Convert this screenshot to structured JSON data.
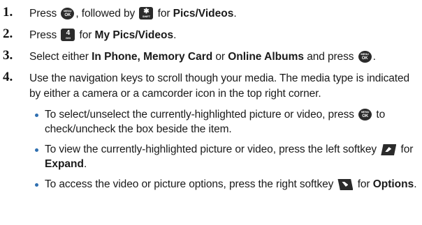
{
  "steps": [
    {
      "num": "1.",
      "t1": "Press ",
      "t2": ", followed by ",
      "t3": " for ",
      "bold": "Pics/Videos",
      "t4": ".",
      "icons": {
        "k1": "menu-ok-key-icon",
        "k2": "star-key-icon"
      },
      "key2": {
        "big": "✱",
        "small": "SHIFT"
      }
    },
    {
      "num": "2.",
      "t1": "Press ",
      "t2": " for ",
      "bold": "My Pics/Videos",
      "t3": ".",
      "icons": {
        "k1": "four-key-icon"
      },
      "key1": {
        "big": "4",
        "small": "GHI"
      }
    },
    {
      "num": "3.",
      "t1": "Select either ",
      "bold": "In Phone, Memory Card",
      "t2": " or ",
      "bold2": "Online Albums",
      "t3": " and press ",
      "t4": ".",
      "icons": {
        "k1": "menu-ok-key-icon"
      }
    },
    {
      "num": "4.",
      "text": "Use the navigation keys to scroll though your media. The media type is indicated by either a camera or a camcorder icon in the top right corner."
    }
  ],
  "bullets": [
    {
      "t1": "To select/unselect the currently-highlighted picture or video, press ",
      "t2": " to check/uncheck the box beside the item.",
      "icon": "menu-ok-key-icon"
    },
    {
      "t1": "To view the currently-highlighted picture or video, press the left softkey ",
      "t2": " for ",
      "bold": "Expand",
      "t3": ".",
      "icon": "left-softkey-icon"
    },
    {
      "t1": "To access the video or picture options, press the right softkey ",
      "t2": " for ",
      "bold": "Options",
      "t3": ".",
      "icon": "right-softkey-icon"
    }
  ],
  "colors": {
    "text": "#1a1a1a",
    "bullet": "#2f6fb0",
    "key": "#2b2b2b"
  }
}
